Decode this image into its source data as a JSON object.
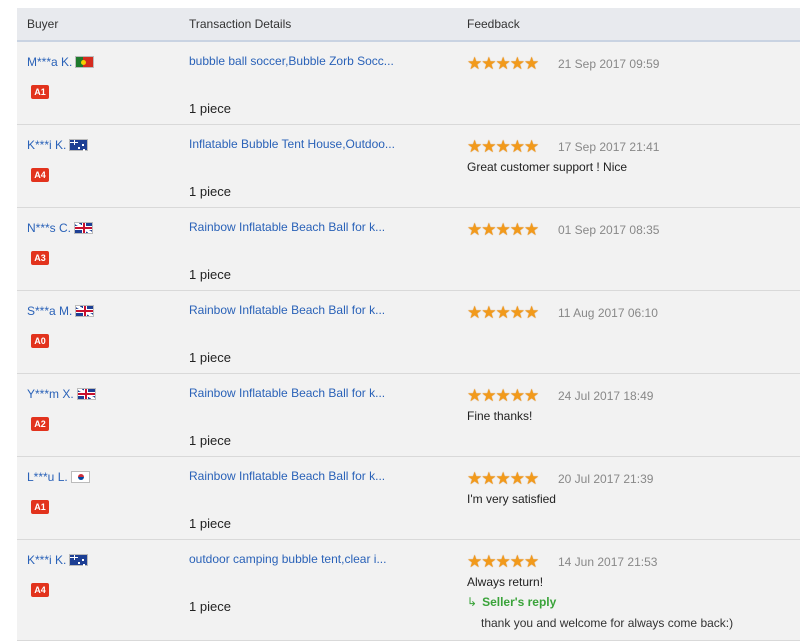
{
  "header": {
    "buyer": "Buyer",
    "transaction": "Transaction Details",
    "feedback": "Feedback"
  },
  "colors": {
    "link": "#2a62b8",
    "badge": "#e2331d",
    "star": "#f29a1b",
    "reply": "#3aa33a"
  },
  "rows": [
    {
      "buyer": "M***a K.",
      "flag": "pt",
      "level": "A1",
      "product": "bubble ball soccer,Bubble Zorb Socc...",
      "quantity": "1 piece",
      "rating": 5,
      "date": "21 Sep 2017 09:59",
      "comment": ""
    },
    {
      "buyer": "K***i K.",
      "flag": "au",
      "level": "A4",
      "product": "Inflatable Bubble Tent House,Outdoo...",
      "quantity": "1 piece",
      "rating": 5,
      "date": "17 Sep 2017 21:41",
      "comment": "Great customer support ! Nice"
    },
    {
      "buyer": "N***s C.",
      "flag": "gb",
      "level": "A3",
      "product": "Rainbow Inflatable Beach Ball for k...",
      "quantity": "1 piece",
      "rating": 5,
      "date": "01 Sep 2017 08:35",
      "comment": ""
    },
    {
      "buyer": "S***a M.",
      "flag": "gb",
      "level": "A0",
      "product": "Rainbow Inflatable Beach Ball for k...",
      "quantity": "1 piece",
      "rating": 5,
      "date": "11 Aug 2017 06:10",
      "comment": ""
    },
    {
      "buyer": "Y***m X.",
      "flag": "gb",
      "level": "A2",
      "product": "Rainbow Inflatable Beach Ball for k...",
      "quantity": "1 piece",
      "rating": 5,
      "date": "24 Jul 2017 18:49",
      "comment": "Fine thanks!"
    },
    {
      "buyer": "L***u L.",
      "flag": "kr",
      "level": "A1",
      "product": "Rainbow Inflatable Beach Ball for k...",
      "quantity": "1 piece",
      "rating": 5,
      "date": "20 Jul 2017 21:39",
      "comment": "I'm very satisfied"
    },
    {
      "buyer": "K***i K.",
      "flag": "au",
      "level": "A4",
      "product": "outdoor camping bubble tent,clear i...",
      "quantity": "1 piece",
      "rating": 5,
      "date": "14 Jun 2017 21:53",
      "comment": "Always return!",
      "reply_title": "Seller's reply",
      "reply_text": "thank you and welcome for always come back:)"
    }
  ]
}
